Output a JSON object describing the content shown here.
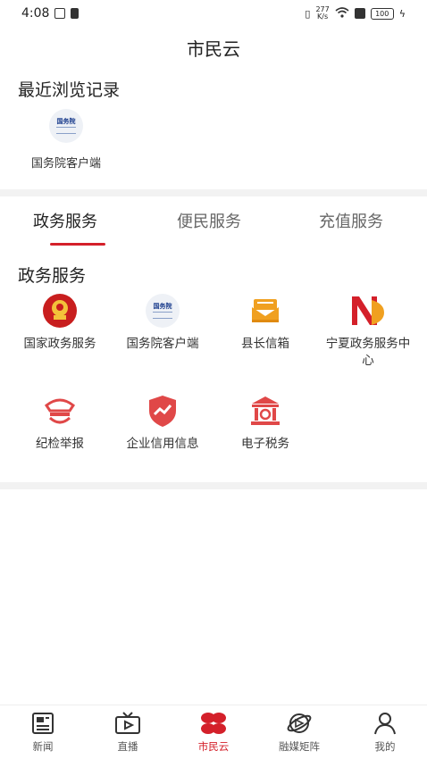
{
  "status_bar": {
    "time": "4:08",
    "net_speed_value": "277",
    "net_speed_unit": "K/s",
    "battery": "100"
  },
  "header": {
    "title": "市民云"
  },
  "recent": {
    "heading": "最近浏览记录",
    "items": [
      {
        "label": "国务院客户端",
        "icon": "gov-council-logo",
        "logo_text": "国务院"
      }
    ]
  },
  "tabs": [
    {
      "label": "政务服务",
      "active": true
    },
    {
      "label": "便民服务",
      "active": false
    },
    {
      "label": "充值服务",
      "active": false
    }
  ],
  "services": {
    "heading": "政务服务",
    "items": [
      {
        "label": "国家政务服务",
        "icon": "national-emblem-icon"
      },
      {
        "label": "国务院客户端",
        "icon": "gov-council-logo",
        "logo_text": "国务院"
      },
      {
        "label": "县长信箱",
        "icon": "mailbox-icon"
      },
      {
        "label": "宁夏政务服务中心",
        "icon": "ningxia-n-logo"
      },
      {
        "label": "纪检举报",
        "icon": "inspection-cap-icon"
      },
      {
        "label": "企业信用信息",
        "icon": "credit-shield-icon"
      },
      {
        "label": "电子税务",
        "icon": "tax-bureau-icon"
      }
    ]
  },
  "bottom_nav": [
    {
      "label": "新闻",
      "icon": "news-icon",
      "active": false
    },
    {
      "label": "直播",
      "icon": "tv-icon",
      "active": false
    },
    {
      "label": "市民云",
      "icon": "clover-icon",
      "active": true
    },
    {
      "label": "融媒矩阵",
      "icon": "globe-icon",
      "active": false
    },
    {
      "label": "我的",
      "icon": "person-icon",
      "active": false
    }
  ],
  "colors": {
    "accent": "#d4202a",
    "divider": "#f2f2f2",
    "orange": "#f0a020"
  }
}
